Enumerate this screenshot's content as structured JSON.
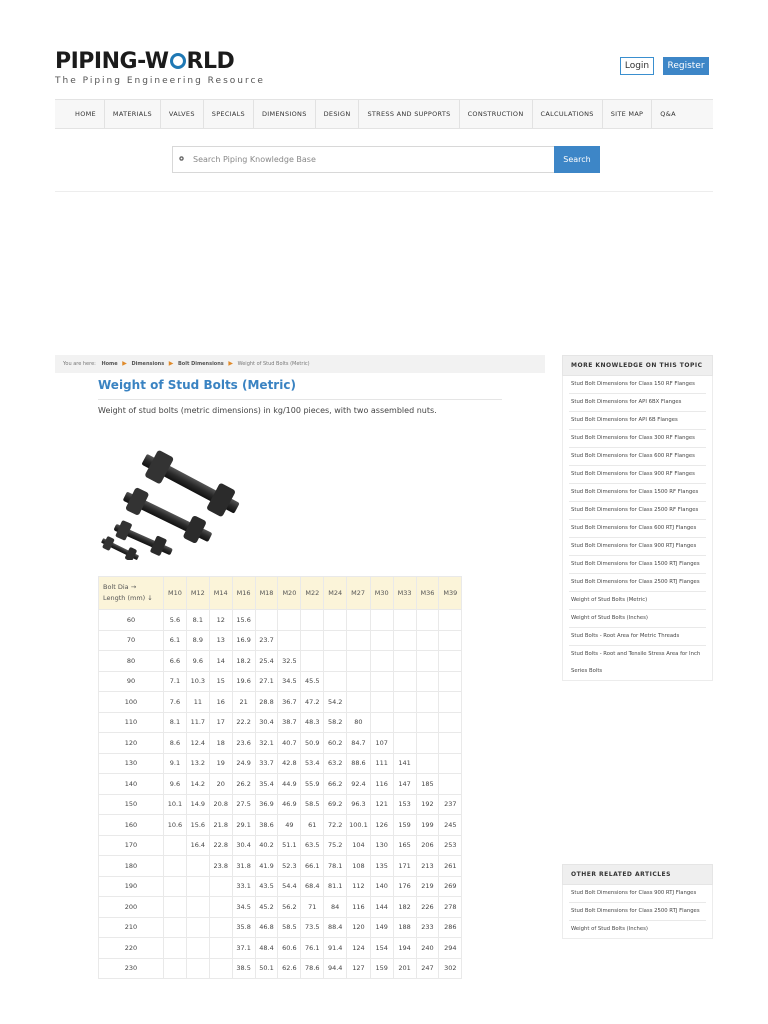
{
  "header": {
    "logo_before": "PIPING-W",
    "logo_after": "RLD",
    "tagline": "The Piping Engineering Resource",
    "login_label": "Login",
    "register_label": "Register"
  },
  "nav": [
    "HOME",
    "MATERIALS",
    "VALVES",
    "SPECIALS",
    "DIMENSIONS",
    "DESIGN",
    "STRESS AND SUPPORTS",
    "CONSTRUCTION",
    "CALCULATIONS",
    "SITE MAP",
    "Q&A"
  ],
  "search": {
    "placeholder": "Search Piping Knowledge Base",
    "button_label": "Search"
  },
  "breadcrumb": {
    "prefix": "You are here:",
    "items": [
      "Home",
      "Dimensions",
      "Bolt Dimensions"
    ],
    "current": "Weight of Stud Bolts (Metric)"
  },
  "article": {
    "title": "Weight of Stud Bolts (Metric)",
    "intro": "Weight of stud bolts (metric dimensions) in kg/100 pieces, with two assembled nuts."
  },
  "table": {
    "first_header": "Bolt Dia → Length (mm) ↓",
    "columns": [
      "M10",
      "M12",
      "M14",
      "M16",
      "M18",
      "M20",
      "M22",
      "M24",
      "M27",
      "M30",
      "M33",
      "M36",
      "M39"
    ],
    "rows": [
      [
        "60",
        "5.6",
        "8.1",
        "12",
        "15.6",
        "",
        "",
        "",
        "",
        "",
        "",
        "",
        "",
        ""
      ],
      [
        "70",
        "6.1",
        "8.9",
        "13",
        "16.9",
        "23.7",
        "",
        "",
        "",
        "",
        "",
        "",
        "",
        ""
      ],
      [
        "80",
        "6.6",
        "9.6",
        "14",
        "18.2",
        "25.4",
        "32.5",
        "",
        "",
        "",
        "",
        "",
        "",
        ""
      ],
      [
        "90",
        "7.1",
        "10.3",
        "15",
        "19.6",
        "27.1",
        "34.5",
        "45.5",
        "",
        "",
        "",
        "",
        "",
        ""
      ],
      [
        "100",
        "7.6",
        "11",
        "16",
        "21",
        "28.8",
        "36.7",
        "47.2",
        "54.2",
        "",
        "",
        "",
        "",
        ""
      ],
      [
        "110",
        "8.1",
        "11.7",
        "17",
        "22.2",
        "30.4",
        "38.7",
        "48.3",
        "58.2",
        "80",
        "",
        "",
        "",
        ""
      ],
      [
        "120",
        "8.6",
        "12.4",
        "18",
        "23.6",
        "32.1",
        "40.7",
        "50.9",
        "60.2",
        "84.7",
        "107",
        "",
        "",
        ""
      ],
      [
        "130",
        "9.1",
        "13.2",
        "19",
        "24.9",
        "33.7",
        "42.8",
        "53.4",
        "63.2",
        "88.6",
        "111",
        "141",
        "",
        ""
      ],
      [
        "140",
        "9.6",
        "14.2",
        "20",
        "26.2",
        "35.4",
        "44.9",
        "55.9",
        "66.2",
        "92.4",
        "116",
        "147",
        "185",
        ""
      ],
      [
        "150",
        "10.1",
        "14.9",
        "20.8",
        "27.5",
        "36.9",
        "46.9",
        "58.5",
        "69.2",
        "96.3",
        "121",
        "153",
        "192",
        "237"
      ],
      [
        "160",
        "10.6",
        "15.6",
        "21.8",
        "29.1",
        "38.6",
        "49",
        "61",
        "72.2",
        "100.1",
        "126",
        "159",
        "199",
        "245"
      ],
      [
        "170",
        "",
        "16.4",
        "22.8",
        "30.4",
        "40.2",
        "51.1",
        "63.5",
        "75.2",
        "104",
        "130",
        "165",
        "206",
        "253"
      ],
      [
        "180",
        "",
        "",
        "23.8",
        "31.8",
        "41.9",
        "52.3",
        "66.1",
        "78.1",
        "108",
        "135",
        "171",
        "213",
        "261"
      ],
      [
        "190",
        "",
        "",
        "",
        "33.1",
        "43.5",
        "54.4",
        "68.4",
        "81.1",
        "112",
        "140",
        "176",
        "219",
        "269"
      ],
      [
        "200",
        "",
        "",
        "",
        "34.5",
        "45.2",
        "56.2",
        "71",
        "84",
        "116",
        "144",
        "182",
        "226",
        "278"
      ],
      [
        "210",
        "",
        "",
        "",
        "35.8",
        "46.8",
        "58.5",
        "73.5",
        "88.4",
        "120",
        "149",
        "188",
        "233",
        "286"
      ],
      [
        "220",
        "",
        "",
        "",
        "37.1",
        "48.4",
        "60.6",
        "76.1",
        "91.4",
        "124",
        "154",
        "194",
        "240",
        "294"
      ],
      [
        "230",
        "",
        "",
        "",
        "38.5",
        "50.1",
        "62.6",
        "78.6",
        "94.4",
        "127",
        "159",
        "201",
        "247",
        "302"
      ]
    ]
  },
  "sidebar": {
    "more_heading": "MORE KNOWLEDGE ON THIS TOPIC",
    "more_items": [
      "Stud Bolt Dimensions for Class 150 RF Flanges",
      "Stud Bolt Dimensions for API 6BX Flanges",
      "Stud Bolt Dimensions for API 6B Flanges",
      "Stud Bolt Dimensions for Class 300 RF Flanges",
      "Stud Bolt Dimensions for Class 600 RF Flanges",
      "Stud Bolt Dimensions for Class 900 RF Flanges",
      "Stud Bolt Dimensions for Class 1500 RF Flanges",
      "Stud Bolt Dimensions for Class 2500 RF Flanges",
      "Stud Bolt Dimensions for Class 600 RTJ Flanges",
      "Stud Bolt Dimensions for Class 900 RTJ Flanges",
      "Stud Bolt Dimensions for Class 1500 RTJ Flanges",
      "Stud Bolt Dimensions for Class 2500 RTJ Flanges",
      "Weight of Stud Bolts (Metric)",
      "Weight of Stud Bolts (Inches)",
      "Stud Bolts - Root Area for Metric Threads",
      "Stud Bolts - Root and Tensile Stress Area for Inch Series Bolts"
    ],
    "other_heading": "OTHER RELATED ARTICLES",
    "other_items": [
      "Stud Bolt Dimensions for Class 900 RTJ Flanges",
      "Stud Bolt Dimensions for Class 2500 RTJ Flanges",
      "Weight of Stud Bolts (Inches)"
    ]
  },
  "colors": {
    "accent": "#3d86c7",
    "table_header_bg": "#fbf4d9",
    "breadcrumb_arrow": "#e08a2a"
  }
}
